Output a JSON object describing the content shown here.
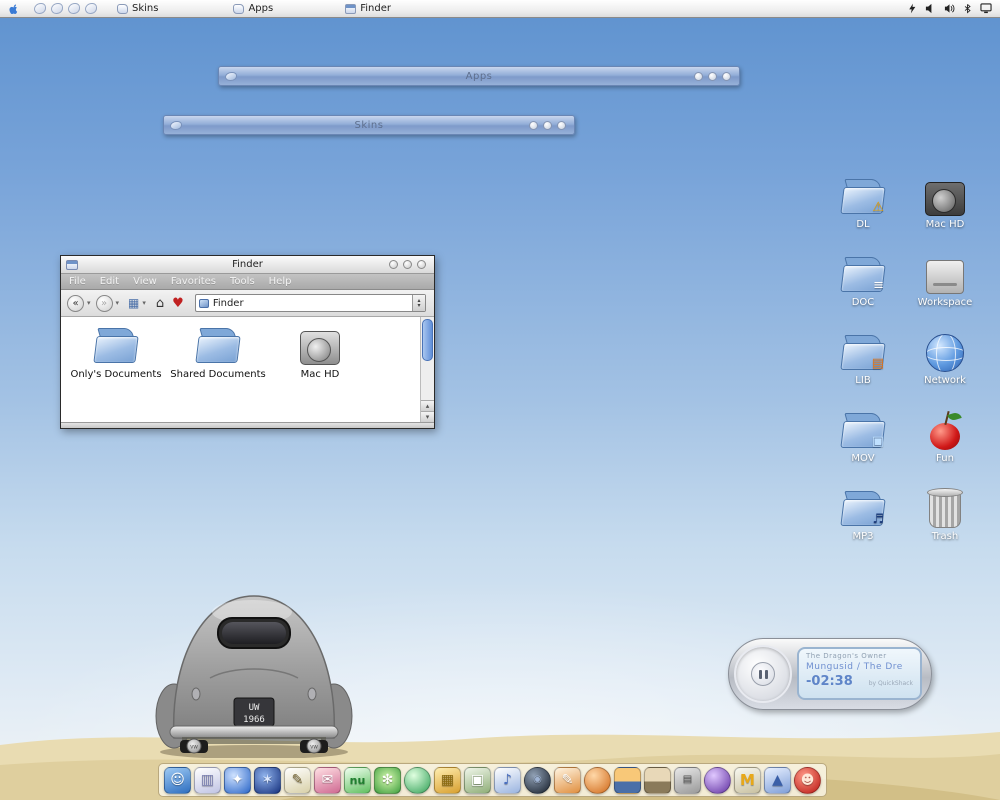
{
  "menubar": {
    "apps": [
      {
        "label": "Skins"
      },
      {
        "label": "Apps"
      },
      {
        "label": "Finder"
      }
    ]
  },
  "shade_bars": [
    {
      "title": "Apps"
    },
    {
      "title": "Skins"
    }
  ],
  "finder": {
    "title": "Finder",
    "menus": [
      "File",
      "Edit",
      "View",
      "Favorites",
      "Tools",
      "Help"
    ],
    "toolbar": {
      "back": "«",
      "back_drop": "▾",
      "forward": "»",
      "forward_drop": "▾",
      "views": "▦",
      "views_drop": "▾",
      "home": "⌂",
      "favorite": "♥",
      "address_value": "Finder",
      "stepper_up": "▴",
      "stepper_down": "▾"
    },
    "items": [
      {
        "label": "Only's Documents"
      },
      {
        "label": "Shared Documents"
      },
      {
        "label": "Mac HD"
      }
    ],
    "scrollbar": {
      "up": "▴",
      "down": "▾"
    }
  },
  "desktop_icons": [
    {
      "label": "DL",
      "badge": "⚠"
    },
    {
      "label": "Mac HD"
    },
    {
      "label": "DOC",
      "badge": "≡"
    },
    {
      "label": "Workspace"
    },
    {
      "label": "LIB",
      "badge": "▤"
    },
    {
      "label": "Network"
    },
    {
      "label": "MOV",
      "badge": "▣"
    },
    {
      "label": "Fun"
    },
    {
      "label": "MP3",
      "badge": "♬"
    },
    {
      "label": "Trash"
    }
  ],
  "car": {
    "plate_line1": "UW",
    "plate_line2": "1966",
    "hubcap": "VW"
  },
  "player": {
    "line1": "The Dragon's Owner",
    "line2": "Mungusid / The Dre",
    "time": "-02:38",
    "credit": "by QuickShack"
  },
  "dock": {
    "items": [
      {
        "name": "dock-item-finder",
        "glyph": "☺",
        "style": "background:linear-gradient(160deg,#9ecaf4,#2f6fc0)",
        "gstyle": "color:#fff"
      },
      {
        "name": "dock-item-contacts",
        "glyph": "▥",
        "style": "background:linear-gradient(160deg,#ffffff,#c0c4e4)",
        "gstyle": "color:#7a7fb0"
      },
      {
        "name": "dock-item-safari",
        "glyph": "✦",
        "style": "background:radial-gradient(circle at 35% 30%,#cfe2ff,#2a66c8)",
        "gstyle": "color:#fff"
      },
      {
        "name": "dock-item-sherlock",
        "glyph": "✶",
        "style": "background:radial-gradient(circle at 38% 32%,#8fb2ec,#17327e)",
        "gstyle": "color:#dce8ff"
      },
      {
        "name": "dock-item-textedit",
        "glyph": "✎",
        "style": "background:linear-gradient(160deg,#ffffff,#d8d0a8)",
        "gstyle": "color:#7a6a3a"
      },
      {
        "name": "dock-item-mail",
        "glyph": "✉",
        "style": "background:linear-gradient(160deg,#ffe0e4,#cf6a92)",
        "gstyle": "color:#fff"
      },
      {
        "name": "dock-item-nu",
        "glyph": "nu",
        "style": "background:linear-gradient(160deg,#f0fff0,#5fbf5f)",
        "gstyle": "color:#1f7f2f;font-size:11px;font-weight:bold"
      },
      {
        "name": "dock-item-flower",
        "glyph": "✻",
        "style": "background:radial-gradient(circle at 50% 42%,#d8f8b0,#3f9f3f)",
        "gstyle": "color:#fff"
      },
      {
        "name": "dock-item-green-orb",
        "glyph": "",
        "style": "background:radial-gradient(circle at 35% 30%,#e0ffe0,#2f9f55);border-radius:50%",
        "gstyle": ""
      },
      {
        "name": "dock-item-stickies",
        "glyph": "▦",
        "style": "background:linear-gradient(160deg,#ffeeb0,#d8a030)",
        "gstyle": "color:#8a6a10"
      },
      {
        "name": "dock-item-preview",
        "glyph": "▣",
        "style": "background:linear-gradient(160deg,#f0f6ea,#8fae78)",
        "gstyle": "color:#fff"
      },
      {
        "name": "dock-item-itunes",
        "glyph": "♪",
        "style": "background:linear-gradient(160deg,#ffffff,#9ab4e0)",
        "gstyle": "color:#4a6fc0"
      },
      {
        "name": "dock-item-dark-orb",
        "glyph": "◉",
        "style": "background:radial-gradient(circle at 35% 30%,#90a0b4,#161e2a);border-radius:50%",
        "gstyle": "color:#9fb4d4;font-size:10px"
      },
      {
        "name": "dock-item-ink",
        "glyph": "✎",
        "style": "background:linear-gradient(160deg,#fff4e0,#e08f3f)",
        "gstyle": "color:#fff"
      },
      {
        "name": "dock-item-orange-orb",
        "glyph": "",
        "style": "background:radial-gradient(circle at 35% 30%,#ffd8a8,#d06818);border-radius:50%",
        "gstyle": ""
      },
      {
        "name": "dock-item-truck",
        "glyph": "",
        "style": "background:linear-gradient(180deg,#f8c878 55%,#4a6fa8 55%)",
        "gstyle": ""
      },
      {
        "name": "dock-item-van",
        "glyph": "",
        "style": "background:linear-gradient(180deg,#e8d8b8 55%,#8a7a5a 55%)",
        "gstyle": ""
      },
      {
        "name": "dock-item-shredder",
        "glyph": "▤",
        "style": "background:linear-gradient(160deg,#e8e8e8,#9a9a9a)",
        "gstyle": "color:#555;font-size:10px"
      },
      {
        "name": "dock-item-purple-orb",
        "glyph": "",
        "style": "background:radial-gradient(circle at 35% 30%,#e0c8ff,#5f2fa0);border-radius:50%",
        "gstyle": ""
      },
      {
        "name": "dock-item-mtv",
        "glyph": "M",
        "style": "background:linear-gradient(160deg,#f8f8f0,#c8c0a0)",
        "gstyle": "color:#e8a818;font-weight:bold;font-size:15px"
      },
      {
        "name": "dock-item-wizard",
        "glyph": "▲",
        "style": "background:linear-gradient(160deg,#e8f0ff,#7f9fd8)",
        "gstyle": "color:#3a5fa8"
      },
      {
        "name": "dock-item-daruma",
        "glyph": "☻",
        "style": "background:radial-gradient(circle at 38% 32%,#ff9a88,#b81410);border-radius:50%",
        "gstyle": "color:#ffe8d8;font-size:13px"
      }
    ]
  }
}
